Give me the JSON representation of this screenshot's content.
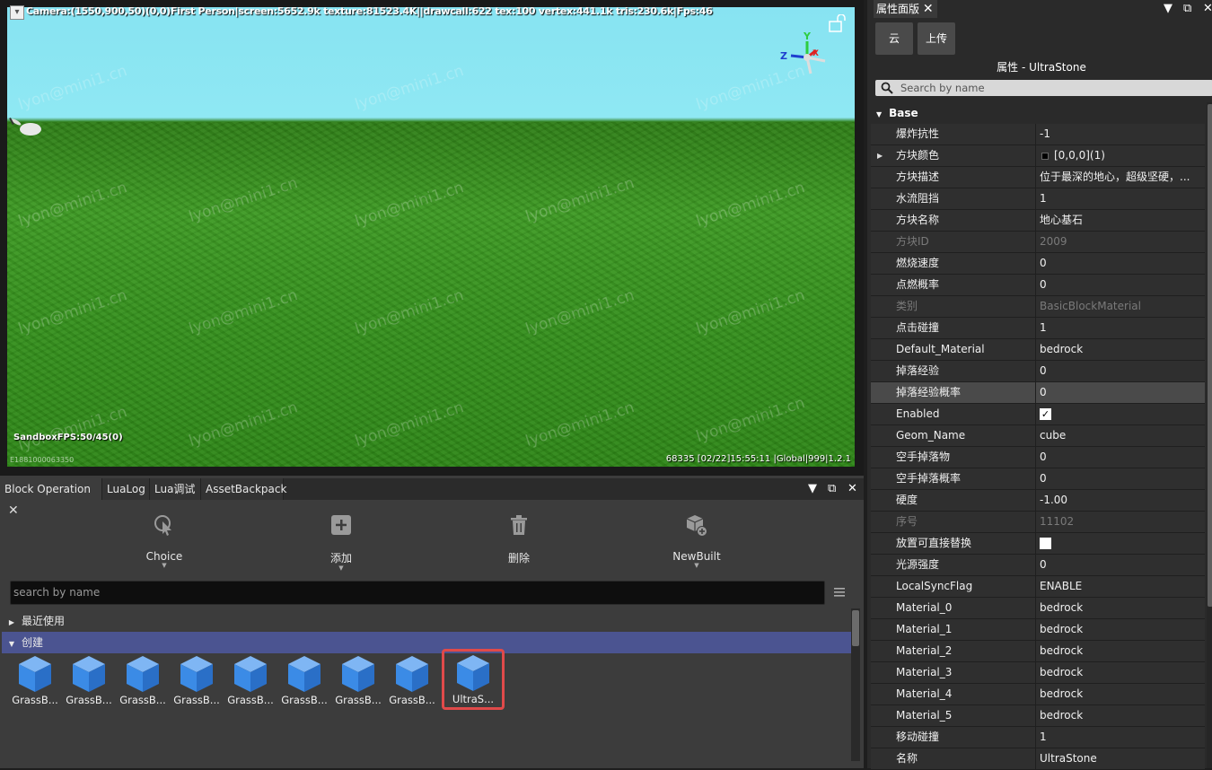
{
  "viewport": {
    "camera_info": "Camera:(1550,900,50)(0,0)First Person|screen:5652.9k texture:81523.4K||drawcall:622 tex:100 vertex:441.1k tris:230.6k|Fps:46",
    "sandbox_fps": "SandboxFPS:50/45(0)",
    "bottom_left_id": "E1881000063350",
    "bottom_right_info": "68335   [02/22]15:55:11  |Global|999|1.2.1",
    "watermark": "lyon@mini1.cn",
    "axis_labels": {
      "y": "Y",
      "z": "Z",
      "x": "X"
    }
  },
  "bottom_panel": {
    "tabs": [
      {
        "label": "Block Operation",
        "active": true,
        "closable": true
      },
      {
        "label": "LuaLog"
      },
      {
        "label": "Lua调试"
      },
      {
        "label": "AssetBackpack"
      }
    ],
    "toolbar": [
      {
        "label": "Choice",
        "icon": "cursor-select-icon",
        "has_dropdown": true
      },
      {
        "label": "添加",
        "icon": "add-square-icon",
        "has_dropdown": true
      },
      {
        "label": "删除",
        "icon": "trash-icon",
        "has_dropdown": false
      },
      {
        "label": "NewBuilt",
        "icon": "new-block-icon",
        "has_dropdown": true
      }
    ],
    "search_placeholder": "search by name",
    "tree": [
      {
        "label": "最近使用",
        "expanded": false
      },
      {
        "label": "创建",
        "expanded": true
      }
    ],
    "blocks": [
      {
        "label": "GrassB..."
      },
      {
        "label": "GrassB..."
      },
      {
        "label": "GrassB..."
      },
      {
        "label": "GrassB..."
      },
      {
        "label": "GrassB..."
      },
      {
        "label": "GrassB..."
      },
      {
        "label": "GrassB..."
      },
      {
        "label": "GrassB..."
      },
      {
        "label": "UltraS...",
        "selected": true
      }
    ]
  },
  "right_panel": {
    "title": "属性面版",
    "buttons": [
      {
        "label": "云"
      },
      {
        "label": "上传"
      }
    ],
    "heading": "属性 - UltraStone",
    "search_placeholder": "Search by name",
    "group": "Base",
    "properties": [
      {
        "key": "爆炸抗性",
        "value": "-1"
      },
      {
        "key": "方块颜色",
        "value": "[0,0,0](1)",
        "expandable": true,
        "swatch": "#000000"
      },
      {
        "key": "方块描述",
        "value": "位于最深的地心，超级坚硬，..."
      },
      {
        "key": "水流阻挡",
        "value": "1"
      },
      {
        "key": "方块名称",
        "value": "地心基石"
      },
      {
        "key": "方块ID",
        "value": "2009",
        "dim": true
      },
      {
        "key": "燃烧速度",
        "value": "0"
      },
      {
        "key": "点燃概率",
        "value": "0"
      },
      {
        "key": "类别",
        "value": "BasicBlockMaterial",
        "dim": true
      },
      {
        "key": "点击碰撞",
        "value": "1"
      },
      {
        "key": "Default_Material",
        "value": "bedrock"
      },
      {
        "key": "掉落经验",
        "value": "0"
      },
      {
        "key": "掉落经验概率",
        "value": "0",
        "highlighted": true
      },
      {
        "key": "Enabled",
        "value": "",
        "checkbox": true,
        "checked": true
      },
      {
        "key": "Geom_Name",
        "value": "cube"
      },
      {
        "key": "空手掉落物",
        "value": "0"
      },
      {
        "key": "空手掉落概率",
        "value": "0"
      },
      {
        "key": "硬度",
        "value": "-1.00"
      },
      {
        "key": "序号",
        "value": "11102",
        "dim": true
      },
      {
        "key": "放置可直接替换",
        "value": "",
        "checkbox": true,
        "checked": false
      },
      {
        "key": "光源强度",
        "value": "0"
      },
      {
        "key": "LocalSyncFlag",
        "value": "ENABLE"
      },
      {
        "key": "Material_0",
        "value": "bedrock"
      },
      {
        "key": "Material_1",
        "value": "bedrock"
      },
      {
        "key": "Material_2",
        "value": "bedrock"
      },
      {
        "key": "Material_3",
        "value": "bedrock"
      },
      {
        "key": "Material_4",
        "value": "bedrock"
      },
      {
        "key": "Material_5",
        "value": "bedrock"
      },
      {
        "key": "移动碰撞",
        "value": "1"
      },
      {
        "key": "名称",
        "value": "UltraStone"
      }
    ]
  },
  "colors": {
    "accent_selected_row": "#4b5491",
    "selection_border": "#e04a4a",
    "block_cube": "#3b8be6",
    "sky": "#8fe8f3",
    "grass": "#3d9a23"
  }
}
